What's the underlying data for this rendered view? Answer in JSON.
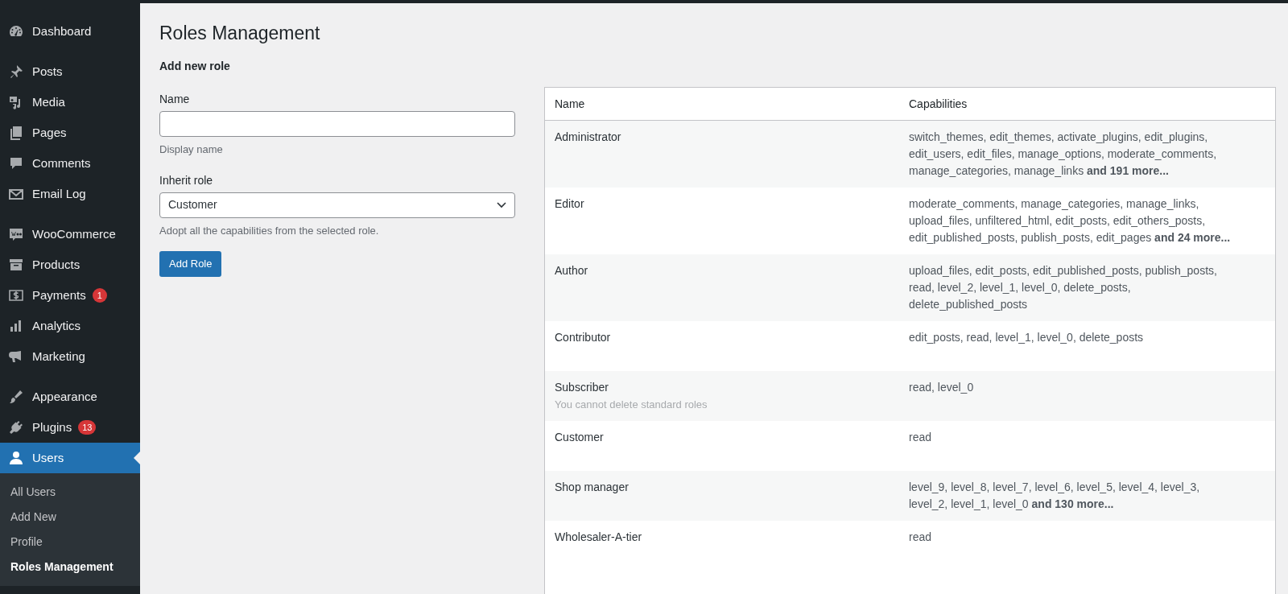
{
  "sidebar": {
    "groups": [
      [
        {
          "label": "Dashboard",
          "selected": false
        }
      ],
      [
        {
          "label": "Posts",
          "selected": false
        },
        {
          "label": "Media",
          "selected": false
        },
        {
          "label": "Pages",
          "selected": false
        },
        {
          "label": "Comments",
          "selected": false
        },
        {
          "label": "Email Log",
          "selected": false
        }
      ],
      [
        {
          "label": "WooCommerce",
          "selected": false
        },
        {
          "label": "Products",
          "selected": false
        },
        {
          "label": "Payments",
          "badge": "1",
          "selected": false
        },
        {
          "label": "Analytics",
          "selected": false
        },
        {
          "label": "Marketing",
          "selected": false
        }
      ],
      [
        {
          "label": "Appearance",
          "selected": false
        },
        {
          "label": "Plugins",
          "badge": "13",
          "selected": false
        },
        {
          "label": "Users",
          "selected": true,
          "submenu": [
            {
              "label": "All Users",
              "selected": false
            },
            {
              "label": "Add New",
              "selected": false
            },
            {
              "label": "Profile",
              "selected": false
            },
            {
              "label": "Roles Management",
              "selected": true
            }
          ]
        }
      ]
    ]
  },
  "page_title": "Roles Management",
  "form": {
    "heading": "Add new role",
    "name_field": {
      "label": "Name",
      "hint": "Display name"
    },
    "inherit_field": {
      "label": "Inherit role",
      "value": "Customer",
      "hint": "Adopt all the capabilities from the selected role."
    },
    "submit_button": "Add Role"
  },
  "table": {
    "columns": [
      "Name",
      "Capabilities"
    ],
    "rows": [
      {
        "name": "Administrator",
        "capabilities": "switch_themes, edit_themes, activate_plugins, edit_plugins, edit_users, edit_files, manage_options, moderate_comments, manage_categories, manage_links **and 191 more...**"
      },
      {
        "name": "Editor",
        "capabilities": "moderate_comments, manage_categories, manage_links, upload_files, unfiltered_html, edit_posts, edit_others_posts, edit_published_posts, publish_posts, edit_pages **and 24 more...**"
      },
      {
        "name": "Author",
        "capabilities": "upload_files, edit_posts, edit_published_posts, publish_posts, read, level_2, level_1, level_0, delete_posts, delete_published_posts"
      },
      {
        "name": "Contributor",
        "capabilities": "edit_posts, read, level_1, level_0, delete_posts"
      },
      {
        "name": "Subscriber",
        "note": "You cannot delete standard roles",
        "capabilities": "read, level_0"
      },
      {
        "name": "Customer",
        "capabilities": "read"
      },
      {
        "name": "Shop manager",
        "capabilities": "level_9, level_8, level_7, level_6, level_5, level_4, level_3, level_2, level_1, level_0 **and 130 more...**"
      },
      {
        "name": "Wholesaler-A-tier",
        "capabilities": "read"
      }
    ]
  }
}
